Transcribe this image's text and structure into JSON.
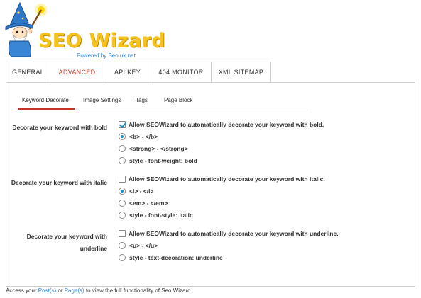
{
  "logo": {
    "title": "SEO Wizard",
    "subtitle": "Powered by Seo.uk.net",
    "mascot_icon": "wizard-mascot-icon",
    "colors": {
      "title": "#f6c21c",
      "subtitle": "#2d7fd8"
    }
  },
  "top_tabs": [
    {
      "label": "GENERAL",
      "active": false
    },
    {
      "label": "ADVANCED",
      "active": true
    },
    {
      "label": "API KEY",
      "active": false
    },
    {
      "label": "404 MONITOR",
      "active": false
    },
    {
      "label": "XML SITEMAP",
      "active": false
    }
  ],
  "sub_tabs": [
    {
      "label": "Keyword Decorate",
      "active": true
    },
    {
      "label": "Image Settings",
      "active": false
    },
    {
      "label": "Tags",
      "active": false
    },
    {
      "label": "Page Block",
      "active": false
    }
  ],
  "sections": [
    {
      "label": "Decorate your keyword with bold",
      "checkbox": {
        "label": "Allow SEOWizard to automatically decorate your keyword with bold.",
        "checked": true
      },
      "options": [
        {
          "label": "<b> - </b>",
          "selected": true
        },
        {
          "label": "<strong> - </strong>",
          "selected": false
        },
        {
          "label": "style - font-weight: bold",
          "selected": false
        }
      ]
    },
    {
      "label": "Decorate your keyword with italic",
      "checkbox": {
        "label": "Allow SEOWizard to automatically decorate your keyword with italic.",
        "checked": false
      },
      "options": [
        {
          "label": "<i> - </i>",
          "selected": true
        },
        {
          "label": "<em> - </em>",
          "selected": false
        },
        {
          "label": "style - font-style: italic",
          "selected": false
        }
      ]
    },
    {
      "label": "Decorate your keyword with underline",
      "checkbox": {
        "label": "Allow SEOWizard to automatically decorate your keyword with underline.",
        "checked": false
      },
      "options": [
        {
          "label": "<u> - </u>",
          "selected": false
        },
        {
          "label": "style - text-decoration: underline",
          "selected": false
        }
      ]
    }
  ],
  "footer": {
    "prefix": "Access your ",
    "link_posts": "Post(s)",
    "middle": " or ",
    "link_pages": "Page(s)",
    "suffix": " to view the full functionality of Seo Wizard."
  },
  "colors": {
    "accent": "#c0392b",
    "link": "#2d7fd8",
    "control": "#1e8cbe"
  }
}
